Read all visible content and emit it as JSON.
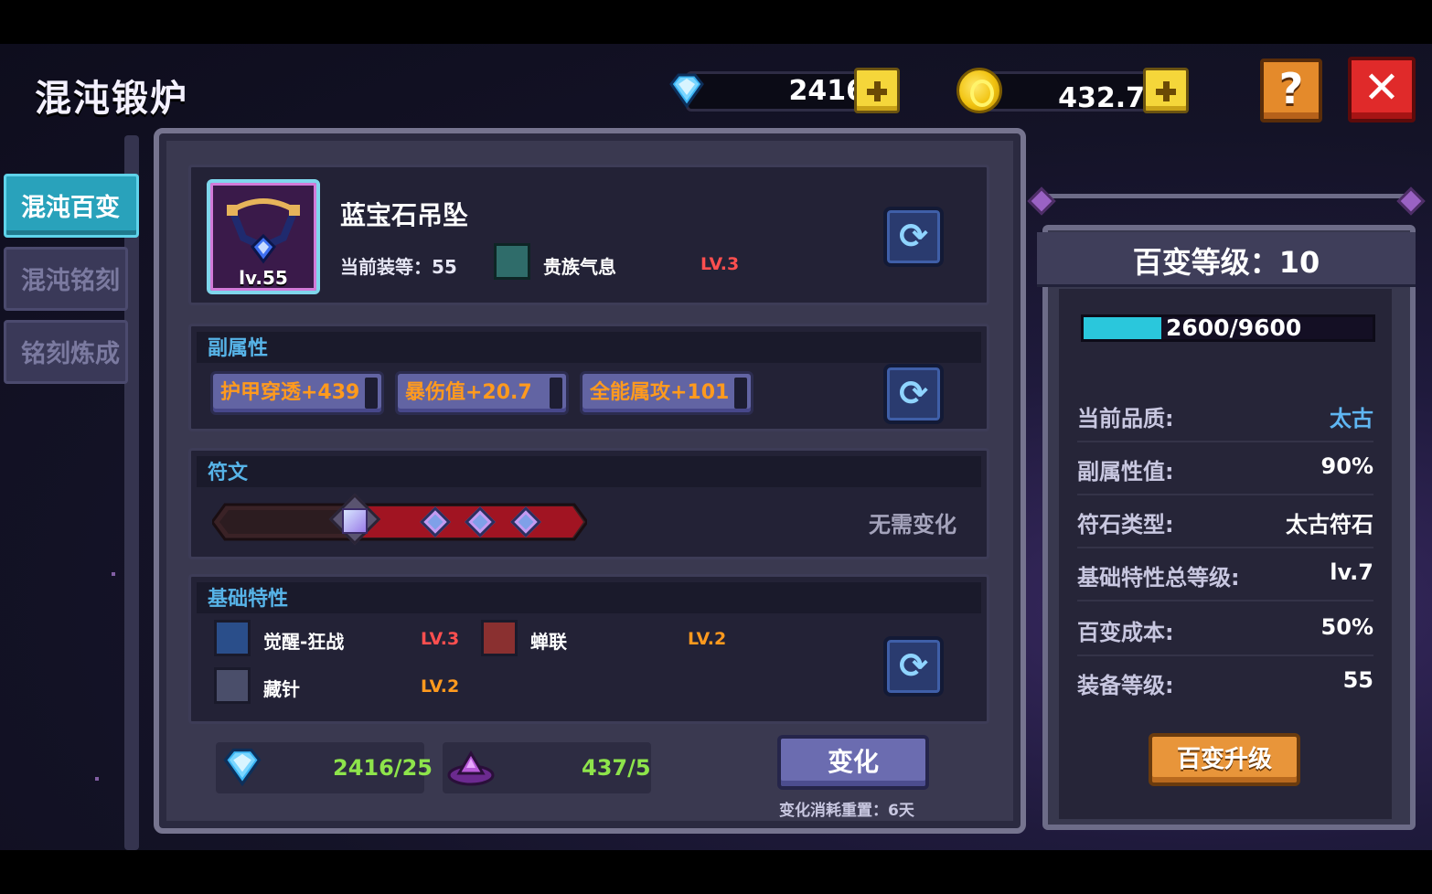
{
  "header": {
    "title": "混沌锻炉",
    "gems": "2416",
    "gold": "432.7万",
    "help_label": "?",
    "close_label": "✕"
  },
  "tabs": [
    {
      "label": "混沌百变",
      "active": true
    },
    {
      "label": "混沌铭刻",
      "active": false
    },
    {
      "label": "铭刻炼成",
      "active": false
    }
  ],
  "item": {
    "name": "蓝宝石吊坠",
    "level_badge": "lv.55",
    "current_level": "当前装等：55",
    "perk_name": "贵族气息",
    "perk_level": "LV.3"
  },
  "sub_attributes": {
    "label": "副属性",
    "values": [
      "护甲穿透+439",
      "暴伤值+20.7",
      "全能属攻+101"
    ]
  },
  "runes": {
    "label": "符文",
    "status": "无需变化"
  },
  "base_traits": {
    "label": "基础特性",
    "traits": [
      {
        "name": "觉醒-狂战",
        "level": "LV.3"
      },
      {
        "name": "蝉联",
        "level": "LV.2"
      },
      {
        "name": "藏针",
        "level": "LV.2"
      }
    ]
  },
  "costs": {
    "gem_cost": "2416/25",
    "crystal_cost": "437/5"
  },
  "change_button": {
    "label": "变化",
    "note": "变化消耗重置：6天"
  },
  "right_panel": {
    "header": "百变等级：10",
    "exp_text": "2600/9600",
    "exp_progress": 0.27,
    "stats": [
      {
        "key": "当前品质:",
        "value": "太古"
      },
      {
        "key": "副属性值:",
        "value": "90%"
      },
      {
        "key": "符石类型:",
        "value": "太古符石"
      },
      {
        "key": "基础特性总等级:",
        "value": "lv.7"
      },
      {
        "key": "百变成本:",
        "value": "50%"
      },
      {
        "key": "装备等级:",
        "value": "55"
      }
    ],
    "upgrade_label": "百变升级"
  },
  "colors": {
    "accent_cyan": "#2ac7dc",
    "quality_blue": "#5fb6f2",
    "level_red": "#ff4f4f",
    "level_orange": "#ff9a1e",
    "attr_orange": "#ff9a1e",
    "cost_green": "#8ee44b",
    "section_label": "#57b4e8"
  }
}
